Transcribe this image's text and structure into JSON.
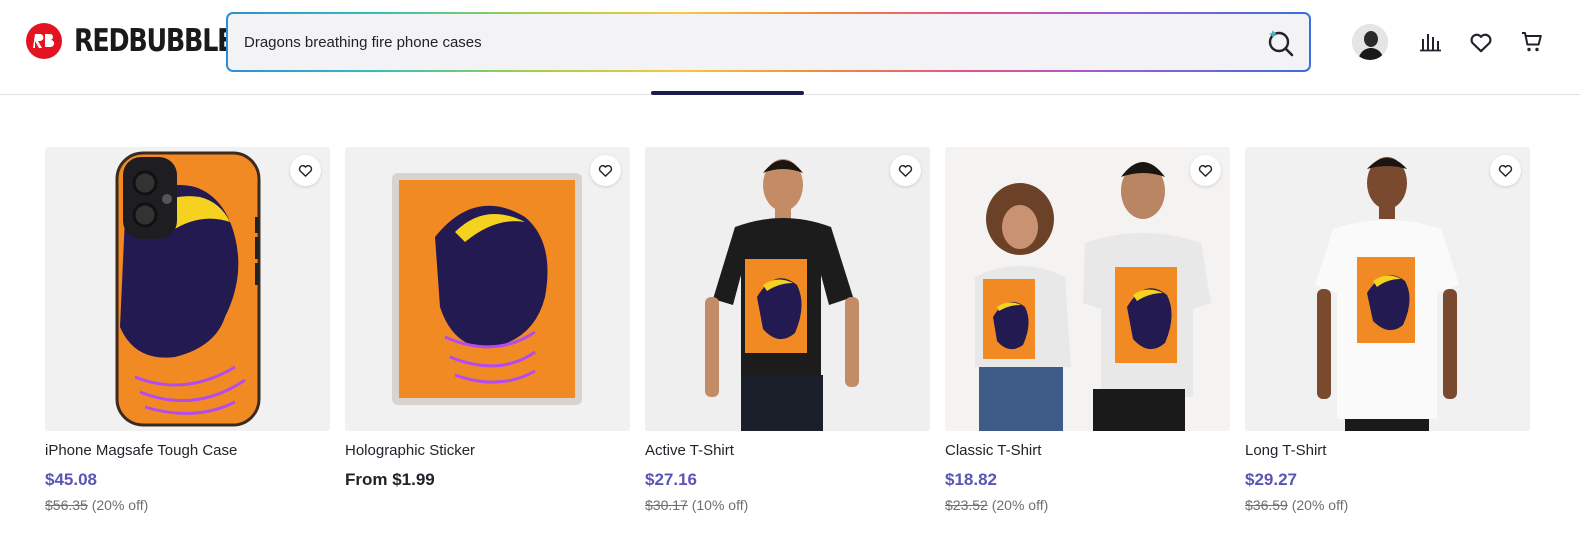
{
  "brand": {
    "name": "REDBUBBLE",
    "color": "#e41321"
  },
  "search": {
    "value": "Dragons breathing fire phone cases",
    "icon": "sparkle-search-icon"
  },
  "header_icons": [
    "avatar",
    "stats-icon",
    "heart-icon",
    "cart-icon"
  ],
  "colors": {
    "price": "#5a55b5",
    "accent": "#1d1d4f"
  },
  "products": [
    {
      "title": "iPhone Magsafe Tough Case",
      "price": "$45.08",
      "old_price": "$56.35",
      "discount": "(20% off)"
    },
    {
      "title": "Holographic Sticker",
      "price": "From $1.99",
      "old_price": "",
      "discount": ""
    },
    {
      "title": "Active T-Shirt",
      "price": "$27.16",
      "old_price": "$30.17",
      "discount": "(10% off)"
    },
    {
      "title": "Classic T-Shirt",
      "price": "$18.82",
      "old_price": "$23.52",
      "discount": "(20% off)"
    },
    {
      "title": "Long T-Shirt",
      "price": "$29.27",
      "old_price": "$36.59",
      "discount": "(20% off)"
    }
  ]
}
